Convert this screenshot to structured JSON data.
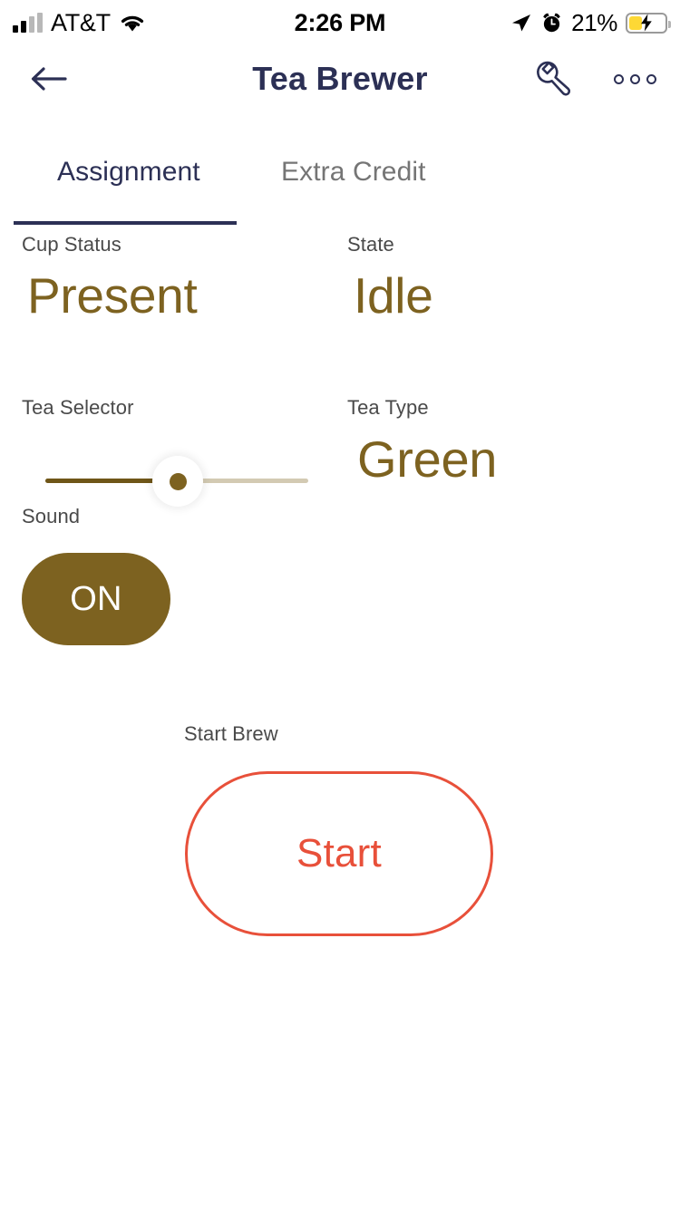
{
  "status_bar": {
    "carrier": "AT&T",
    "signal_icon": "signal-bars-icon",
    "wifi_icon": "wifi-icon",
    "time": "2:26 PM",
    "location_icon": "location-arrow-icon",
    "alarm_icon": "alarm-clock-icon",
    "battery_percent": "21%",
    "battery_level": 21,
    "battery_icon": "battery-charging-icon",
    "battery_fill_color": "#fdd835"
  },
  "header": {
    "back_icon": "arrow-left-icon",
    "title": "Tea Brewer",
    "settings_icon": "wrench-icon",
    "overflow_icon": "more-horizontal-icon",
    "title_color": "#2c3055"
  },
  "tabs": {
    "items": [
      {
        "label": "Assignment",
        "active": true
      },
      {
        "label": "Extra Credit",
        "active": false
      }
    ],
    "active_color": "#2c3055",
    "inactive_color": "#757575"
  },
  "fields": {
    "cup_status": {
      "label": "Cup Status",
      "value": "Present"
    },
    "state": {
      "label": "State",
      "value": "Idle"
    },
    "tea_selector": {
      "label": "Tea Selector",
      "value": 50,
      "min": 0,
      "max": 100
    },
    "tea_type": {
      "label": "Tea Type",
      "value": "Green"
    },
    "sound": {
      "label": "Sound",
      "value": "ON",
      "enabled": true
    },
    "start_brew": {
      "label": "Start Brew",
      "button_label": "Start"
    }
  },
  "colors": {
    "accent_brown": "#7d6220",
    "track_inactive": "#d3cab3",
    "track_active": "#6f5618",
    "start_red": "#e8503a",
    "navy": "#2c3055",
    "label_gray": "#4a4a4a",
    "background": "#ffffff"
  }
}
